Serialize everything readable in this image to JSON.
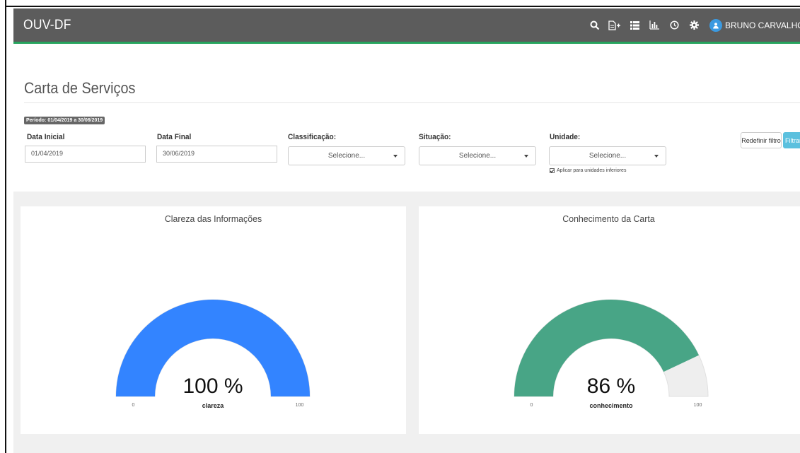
{
  "app": {
    "brand": "OUV-DF",
    "user_name": "BRUNO CARVALHO DA SILV"
  },
  "nav_icons": [
    "search-icon",
    "new-document-icon",
    "list-icon",
    "bar-chart-icon",
    "clock-icon",
    "gear-icon",
    "user-icon"
  ],
  "page": {
    "title": "Carta de Serviços",
    "period_badge": "Período: 01/04/2019 a 30/06/2019"
  },
  "filters": {
    "data_inicial": {
      "label": "Data Inicial",
      "value": "01/04/2019"
    },
    "data_final": {
      "label": "Data Final",
      "value": "30/06/2019"
    },
    "classificacao": {
      "label": "Classificação:",
      "value": "Selecione..."
    },
    "situacao": {
      "label": "Situação:",
      "value": "Selecione..."
    },
    "unidade": {
      "label": "Unidade:",
      "value": "Selecione..."
    },
    "aplicar_inferiores": {
      "label": "Aplicar para unidades inferiores",
      "checked": true
    },
    "reset_label": "Redefinir filtro",
    "filter_label": "Filtrar"
  },
  "gauges": [
    {
      "title": "Clareza das Informações",
      "value": 100,
      "value_text": "100 %",
      "label": "clareza",
      "min": "0",
      "max": "100",
      "color": "#3384ff"
    },
    {
      "title": "Conhecimento da Carta",
      "value": 86,
      "value_text": "86 %",
      "label": "conhecimento",
      "min": "0",
      "max": "100",
      "color": "#48a586"
    }
  ],
  "colors": {
    "navbar": "#5c5c5c",
    "navbar_accent": "#27a45e",
    "gauge_track": "#eeeeee",
    "filter_button": "#5bc0de"
  }
}
